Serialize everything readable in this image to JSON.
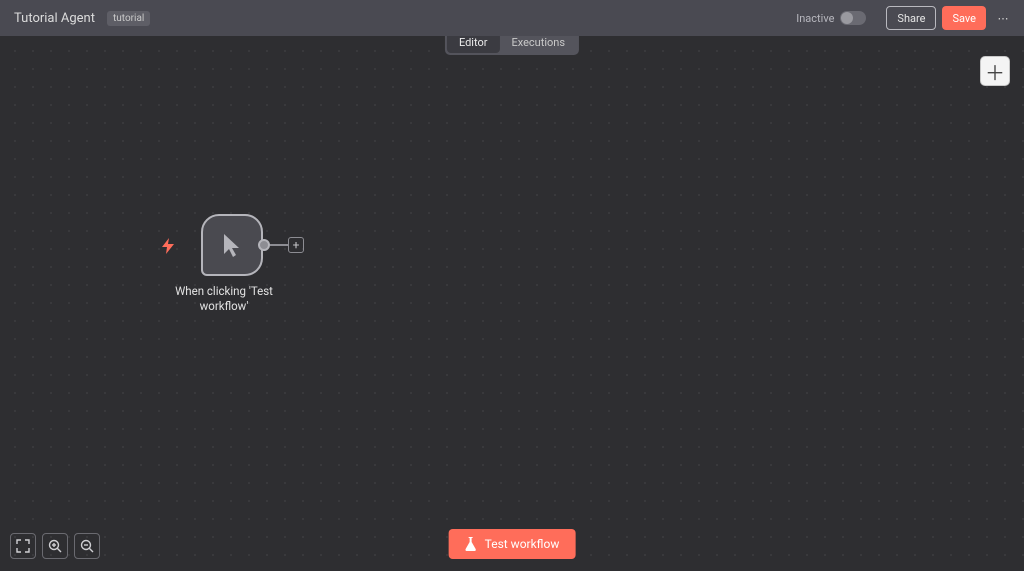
{
  "header": {
    "title": "Tutorial Agent",
    "tag": "tutorial",
    "status_label": "Inactive",
    "share_label": "Share",
    "save_label": "Save"
  },
  "tabs": {
    "editor_label": "Editor",
    "executions_label": "Executions",
    "active": "editor"
  },
  "canvas": {
    "trigger_node": {
      "label": "When clicking 'Test workflow'"
    }
  },
  "footer": {
    "test_workflow_label": "Test workflow"
  }
}
